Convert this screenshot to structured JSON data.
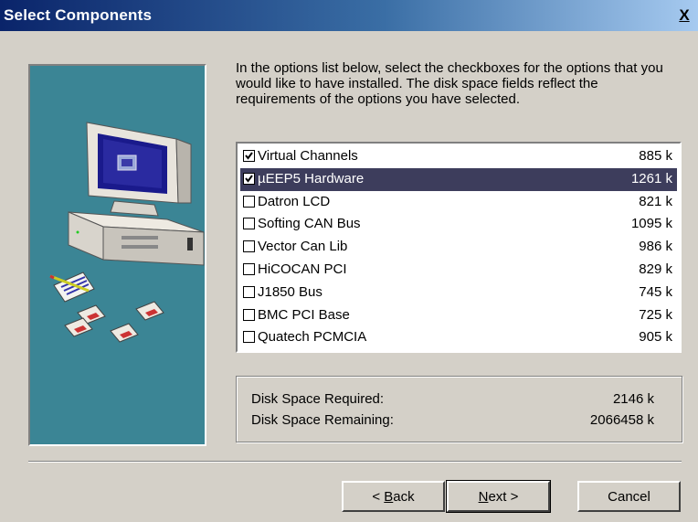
{
  "window": {
    "title": "Select Components",
    "close_glyph": "X"
  },
  "intro_text": "In the options list below, select the checkboxes for the options that you would like to have installed.  The disk space fields reflect the requirements of the options you have selected.",
  "components": [
    {
      "name": "Virtual Channels",
      "size": "885 k",
      "checked": true,
      "selected": false
    },
    {
      "name": "µEEP5 Hardware",
      "size": "1261 k",
      "checked": true,
      "selected": true
    },
    {
      "name": "Datron LCD",
      "size": "821 k",
      "checked": false,
      "selected": false
    },
    {
      "name": "Softing CAN Bus",
      "size": "1095 k",
      "checked": false,
      "selected": false
    },
    {
      "name": "Vector Can Lib",
      "size": "986 k",
      "checked": false,
      "selected": false
    },
    {
      "name": "HiCOCAN PCI",
      "size": "829 k",
      "checked": false,
      "selected": false
    },
    {
      "name": "J1850 Bus",
      "size": "745 k",
      "checked": false,
      "selected": false
    },
    {
      "name": "BMC PCI Base",
      "size": "725 k",
      "checked": false,
      "selected": false
    },
    {
      "name": "Quatech PCMCIA",
      "size": "905 k",
      "checked": false,
      "selected": false
    }
  ],
  "disk": {
    "required_label": "Disk Space Required:",
    "required_value": "2146 k",
    "remaining_label": "Disk Space Remaining:",
    "remaining_value": "2066458 k"
  },
  "buttons": {
    "back_prefix": "< ",
    "back_mnemonic": "B",
    "back_rest": "ack",
    "next_mnemonic": "N",
    "next_rest": "ext >",
    "cancel": "Cancel"
  },
  "colors": {
    "art_background": "#3b8595",
    "selection": "#3d3d5c",
    "titlebar_start": "#0a246a",
    "titlebar_end": "#a6caf0"
  }
}
